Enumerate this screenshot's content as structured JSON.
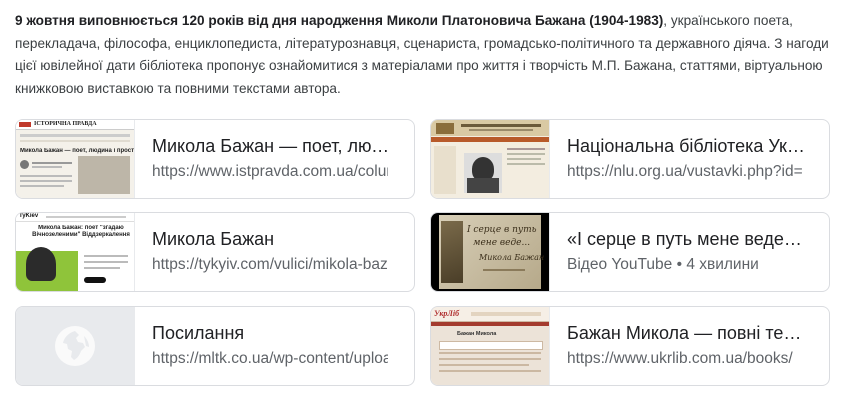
{
  "intro": {
    "bold": "9 жовтня виповнюється 120 років від дня народження Миколи Платоновича Бажана (1904-1983)",
    "rest": ", українського поета, перекладача, філософа, енциклопедиста, літературознавця, сценариста, громадсько-політичного та державного діяча. З нагоди цієї ювілейної дати бібліотека пропонує ознайомитися з матеріалами про життя і творчість М.П. Бажана, статтями, віртуальною книжковою виставкою та повними текстами автора."
  },
  "cards": [
    {
      "title": "Микола Бажан — поет, людина і простір",
      "url": "https://www.istpravda.com.ua/columns/",
      "thumb": {
        "header": "ІСТОРИЧНА ПРАВДА",
        "headline": "Микола Бажан — поет, людина і простір"
      }
    },
    {
      "title": "Національна бібліотека України для дітей",
      "url": "https://nlu.org.ua/vustavki.php?id=",
      "thumb": {}
    },
    {
      "title": "Микола Бажан",
      "url": "https://tykyiv.com/vulici/mikola-bazhan",
      "thumb": {
        "logo": "TyKiev",
        "headline": "Микола Бажан: поет \"згадаю Вічнозеленими\" Віддзеркалення"
      }
    },
    {
      "title": "«І серце в путь мене веде...»",
      "url": "Відео YouTube • 4 хвилини",
      "thumb": {
        "line1": "І серце в путь",
        "line2": "мене веде...",
        "name": "Микола Бажан"
      }
    },
    {
      "title": "Посилання",
      "url": "https://mltk.co.ua/wp-content/uploads",
      "thumb": {
        "icon": "globe-icon"
      }
    },
    {
      "title": "Бажан Микола — повні тексти творів",
      "url": "https://www.ukrlib.com.ua/books/",
      "thumb": {
        "logo": "УкрЛіб",
        "name": "Бажан Микола"
      }
    }
  ]
}
